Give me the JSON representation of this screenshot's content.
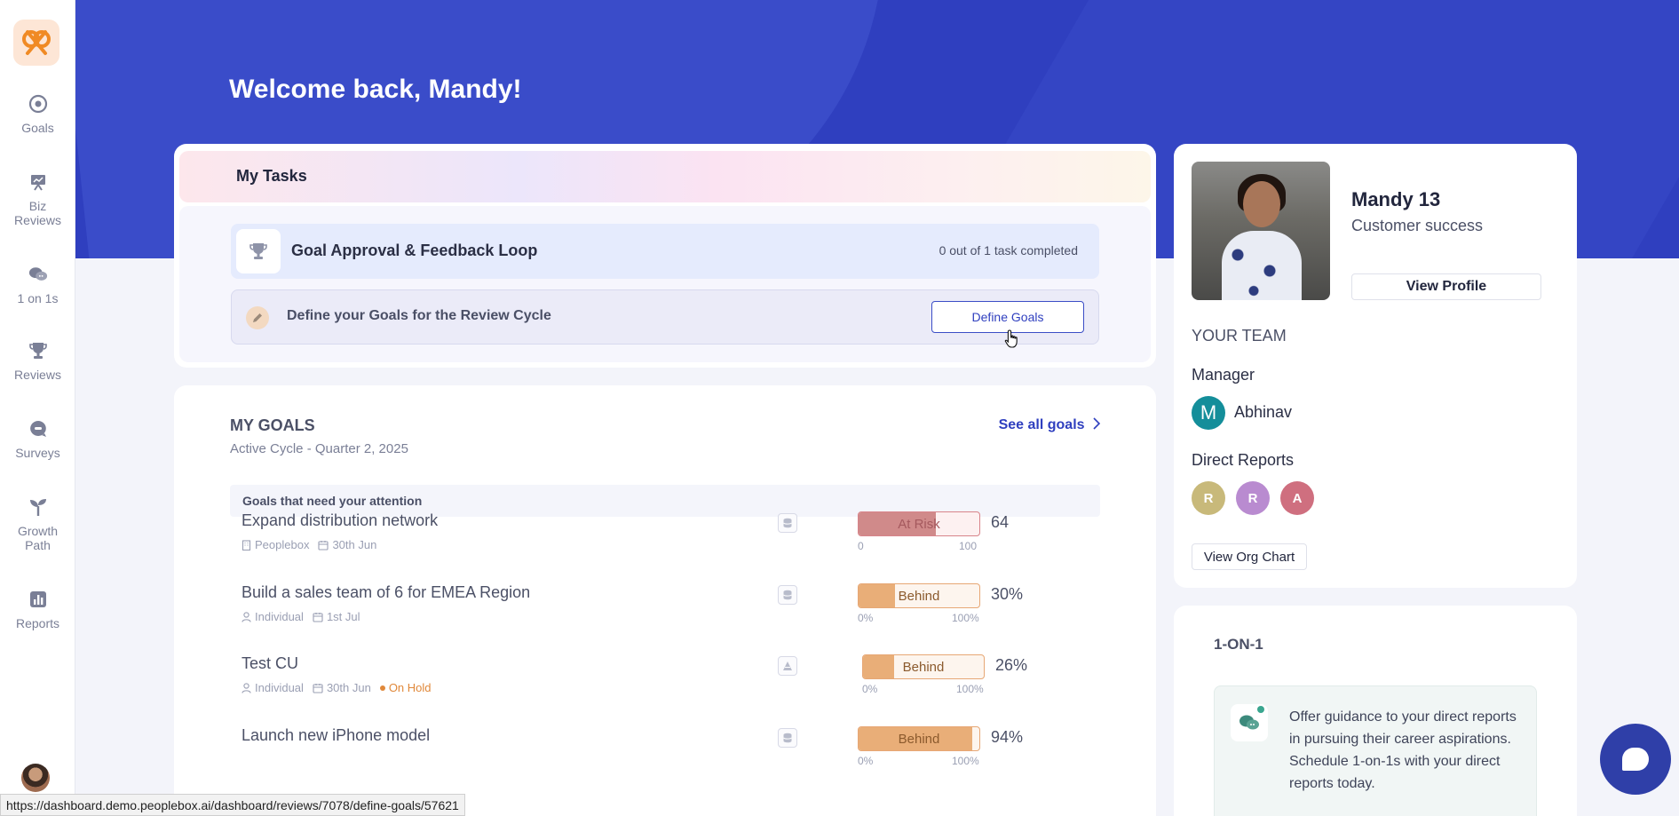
{
  "sidebar": {
    "items": [
      {
        "label": "Goals"
      },
      {
        "label": "Biz\nReviews"
      },
      {
        "label": "1 on 1s"
      },
      {
        "label": "Reviews"
      },
      {
        "label": "Surveys"
      },
      {
        "label": "Growth\nPath"
      },
      {
        "label": "Reports"
      }
    ]
  },
  "header": {
    "welcome": "Welcome back, Mandy!"
  },
  "tasks": {
    "title": "My Tasks",
    "group_title": "Goal Approval & Feedback Loop",
    "group_count": "0 out of 1 task completed",
    "task_label": "Define your Goals for the Review Cycle",
    "task_button": "Define Goals"
  },
  "goals": {
    "title": "MY GOALS",
    "subtitle": "Active Cycle - Quarter 2, 2025",
    "see_all": "See all goals",
    "attention": "Goals that need your attention",
    "items": [
      {
        "name": "Expand distribution network",
        "meta1": "Peoplebox",
        "date": "30th Jun",
        "status": "At Risk",
        "value": "64",
        "progress": 0.64,
        "scale_min": "0",
        "scale_max": "100",
        "hold": ""
      },
      {
        "name": "Build a sales team of 6 for EMEA Region",
        "meta1": "Individual",
        "date": "1st Jul",
        "status": "Behind",
        "value": "30%",
        "progress": 0.3,
        "scale_min": "0%",
        "scale_max": "100%",
        "hold": ""
      },
      {
        "name": "Test CU",
        "meta1": "Individual",
        "date": "30th Jun",
        "status": "Behind",
        "value": "26%",
        "progress": 0.26,
        "scale_min": "0%",
        "scale_max": "100%",
        "hold": "On Hold"
      },
      {
        "name": "Launch new iPhone model",
        "meta1": "",
        "date": "",
        "status": "Behind",
        "value": "94%",
        "progress": 0.94,
        "scale_min": "0%",
        "scale_max": "100%",
        "hold": ""
      }
    ]
  },
  "profile": {
    "name": "Mandy 13",
    "role": "Customer success",
    "view_profile": "View Profile",
    "team_heading": "YOUR TEAM",
    "manager_label": "Manager",
    "manager_initial": "M",
    "manager_name": "Abhinav",
    "direct_reports_label": "Direct Reports",
    "direct_reports": [
      {
        "initial": "R",
        "color": "#c8b97a"
      },
      {
        "initial": "R",
        "color": "#b98bd0"
      },
      {
        "initial": "A",
        "color": "#cf6f7f"
      }
    ],
    "org_chart": "View Org Chart"
  },
  "oneone": {
    "title": "1-ON-1",
    "text": "Offer guidance to your direct reports in pursuing their career aspirations.\nSchedule 1-on-1s with your direct reports today."
  },
  "status_url": "https://dashboard.demo.peoplebox.ai/dashboard/reviews/7078/define-goals/57621",
  "colors": {
    "brand": "#2f3fbf",
    "at_risk": "#d08a8a",
    "behind": "#e9ae78"
  }
}
